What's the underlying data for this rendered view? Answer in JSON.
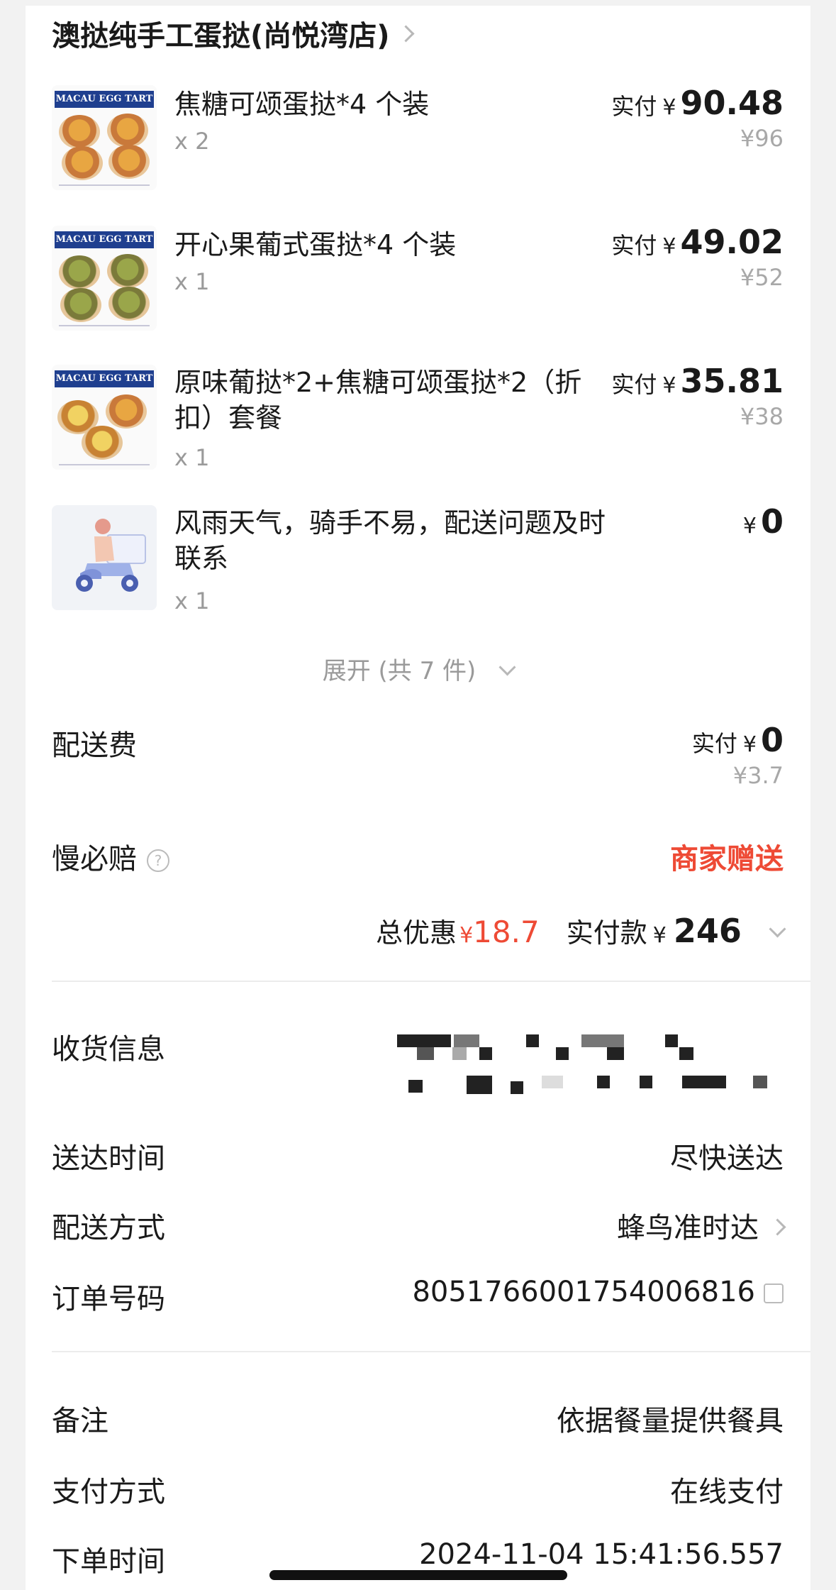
{
  "store": {
    "name": "澳挞纯手工蛋挞(尚悦湾店)"
  },
  "items": [
    {
      "name": "焦糖可颂蛋挞*4 个装",
      "qty": "x 2",
      "paid_label": "实付",
      "currency": "¥",
      "paid": "90.48",
      "original": "¥96",
      "thumb_banner": "MACAU EGG TART"
    },
    {
      "name": "开心果葡式蛋挞*4 个装",
      "qty": "x 1",
      "paid_label": "实付",
      "currency": "¥",
      "paid": "49.02",
      "original": "¥52",
      "thumb_banner": "MACAU EGG TART"
    },
    {
      "name": "原味葡挞*2+焦糖可颂蛋挞*2（折扣）套餐",
      "qty": "x 1",
      "paid_label": "实付",
      "currency": "¥",
      "paid": "35.81",
      "original": "¥38",
      "thumb_banner": "MACAU EGG TART"
    },
    {
      "name": "风雨天气，骑手不易，配送问题及时联系",
      "qty": "x 1",
      "currency": "¥",
      "paid": "0"
    }
  ],
  "expand": {
    "label": "展开 (共 7 件)"
  },
  "delivery_fee": {
    "label": "配送费",
    "paid_label": "实付",
    "currency": "¥",
    "paid": "0",
    "original": "¥3.7"
  },
  "slow_compensation": {
    "label": "慢必赔",
    "value": "商家赠送",
    "help_icon": "?"
  },
  "summary": {
    "discount_label": "总优惠",
    "discount_currency": "¥",
    "discount": "18.7",
    "paid_label": "实付款",
    "paid_currency": "¥",
    "paid": "246"
  },
  "info": {
    "receiver_label": "收货信息",
    "delivery_time_label": "送达时间",
    "delivery_time": "尽快送达",
    "delivery_method_label": "配送方式",
    "delivery_method": "蜂鸟准时达",
    "order_no_label": "订单号码",
    "order_no": "8051766001754006816",
    "remark_label": "备注",
    "remark": "依据餐量提供餐具",
    "payment_label": "支付方式",
    "payment": "在线支付",
    "order_time_label": "下单时间",
    "order_time": "2024-11-04 15:41:56.557"
  },
  "colors": {
    "accent_red": "#ee4a35",
    "muted": "#9a9a9a",
    "banner_blue": "#1f3f8f"
  }
}
